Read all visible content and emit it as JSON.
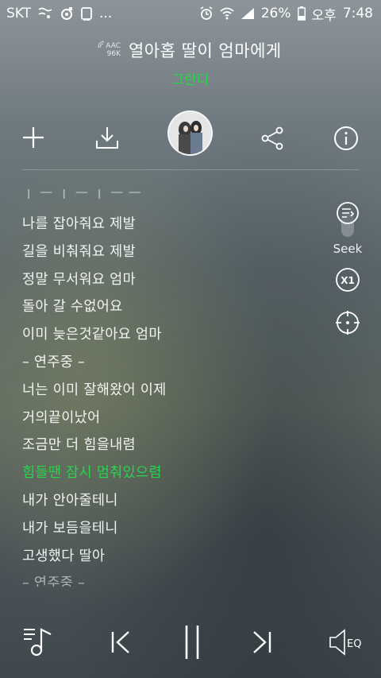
{
  "status_bar": {
    "carrier": "SKT",
    "more": "...",
    "battery_percent": "26%",
    "ampm": "오후",
    "time": "7:48"
  },
  "header": {
    "codec_top": "AAC",
    "codec_bottom": "96K",
    "title": "열아홉 딸이 엄마에게",
    "artist": "그란디"
  },
  "actions": {
    "add_icon": "plus-icon",
    "download_icon": "download-icon",
    "share_icon": "share-icon",
    "info_icon": "info-icon"
  },
  "lyrics": {
    "lines": [
      "나를 잡아줘요 제발",
      "길을 비춰줘요 제발",
      "정말 무서워요 엄마",
      "돌아 갈 수없어요",
      "이미 늦은것같아요 엄마",
      "– 연주중 –",
      "너는 이미 잘해왔어 이제",
      "거의끝이났어",
      "조금만 더 힘을내렴",
      "힘들땐 잠시 멈춰있으렴",
      "내가 안아줄테니",
      "내가 보듬을테니",
      "고생했다 딸아",
      "– 연주중 –"
    ],
    "active_index": 9,
    "active_color": "#27d64b"
  },
  "side_controls": {
    "seek_label": "Seek",
    "speed_label": "X1"
  },
  "player": {
    "eq_label": "EQ"
  }
}
